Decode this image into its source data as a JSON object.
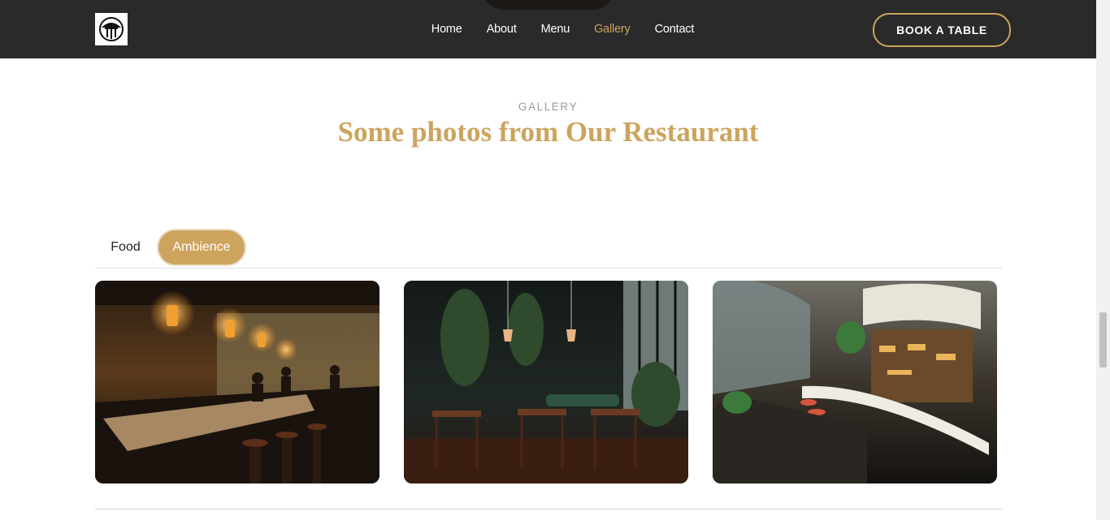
{
  "header": {
    "nav": [
      "Home",
      "About",
      "Menu",
      "Gallery",
      "Contact"
    ],
    "active_nav": "Gallery",
    "book_button": "BOOK A TABLE"
  },
  "gallery": {
    "eyebrow": "GALLERY",
    "title": "Some photos from Our Restaurant",
    "tabs": [
      "Food",
      "Ambience"
    ],
    "active_tab": "Ambience"
  },
  "colors": {
    "accent": "#cda45e",
    "header_bg": "#2a2a2a"
  }
}
